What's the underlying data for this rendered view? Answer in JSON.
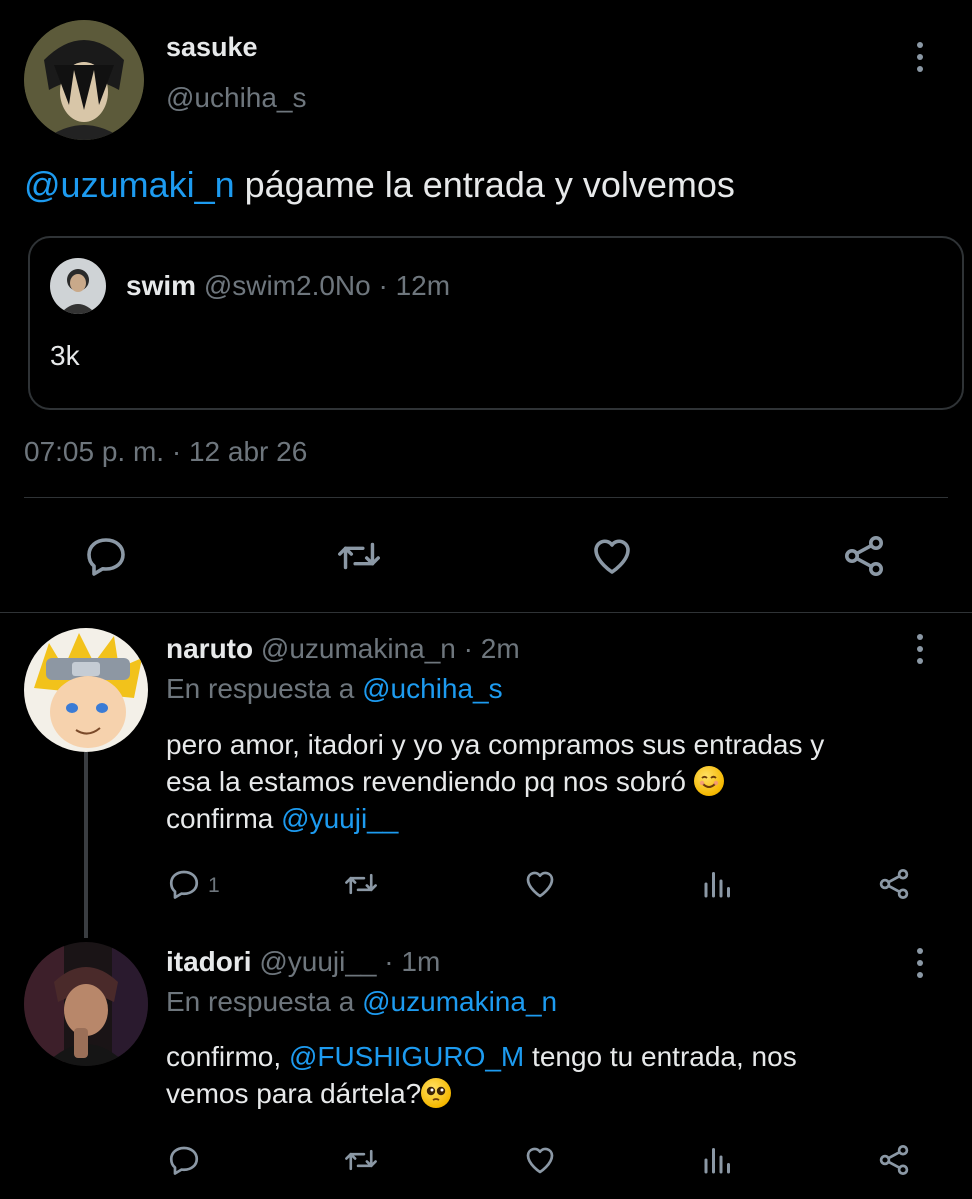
{
  "main_tweet": {
    "name": "sasuke",
    "handle": "@uchiha_s",
    "mention": "@uzumaki_n",
    "text": " págame la entrada y volvemos",
    "quote": {
      "name": "swim",
      "handle": "@swim2.0No",
      "time": "· 12m",
      "text": "3k"
    },
    "timestamp": "07:05 p. m. · 12 abr 26",
    "actions": [
      "reply-icon",
      "retweet-icon",
      "like-icon",
      "share-icon"
    ]
  },
  "replies": [
    {
      "name": "naruto",
      "handle": "@uzumakina_n",
      "time": "· 2m",
      "reply_prefix": "En respuesta a ",
      "reply_to": "@uchiha_s",
      "line1": "pero amor, itadori y yo ya compramos sus entradas y",
      "line2": "esa la estamos revendiendo pq nos sobró",
      "line3_text": "confirma ",
      "line3_mention": "@yuuji__",
      "reply_count": "1"
    },
    {
      "name": "itadori",
      "handle": "@yuuji__",
      "time": "· 1m",
      "reply_prefix": "En respuesta a ",
      "reply_to": "@uzumakina_n",
      "line1_text": "confirmo, ",
      "line1_mention": "@FUSHIGURO_M",
      "line1_rest": " tengo tu entrada, nos",
      "line2": "vemos para dártela?",
      "reply_count": ""
    }
  ],
  "colors": {
    "background": "#000000",
    "link": "#1d9bf0",
    "muted": "#6e767d",
    "text": "#e7e9ea"
  }
}
